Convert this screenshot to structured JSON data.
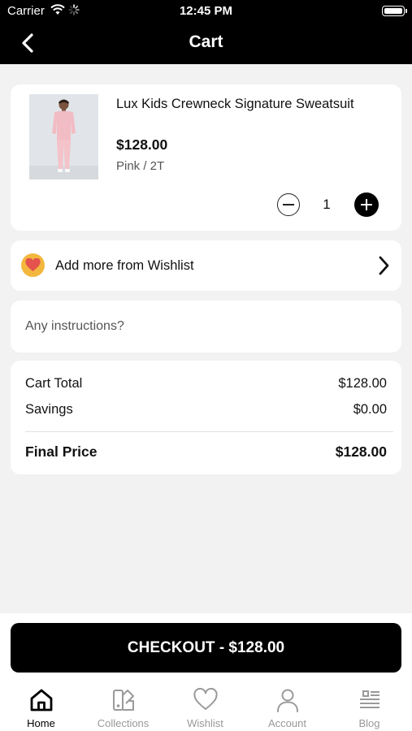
{
  "status_bar": {
    "carrier": "Carrier",
    "time": "12:45 PM"
  },
  "nav": {
    "title": "Cart",
    "back_icon": "chevron-left-icon"
  },
  "cart_item": {
    "name": "Lux Kids Crewneck Signature Sweatsuit",
    "price": "$128.00",
    "variant": "Pink / 2T",
    "quantity": "1"
  },
  "wishlist_row": {
    "label": "Add more from Wishlist",
    "icon": "heart-icon",
    "accent": "#f3b73e"
  },
  "instructions": {
    "placeholder": "Any instructions?"
  },
  "summary": {
    "cart_total_label": "Cart Total",
    "cart_total_value": "$128.00",
    "savings_label": "Savings",
    "savings_value": "$0.00",
    "final_label": "Final Price",
    "final_value": "$128.00"
  },
  "checkout": {
    "label": "CHECKOUT - $128.00"
  },
  "tabs": [
    {
      "label": "Home",
      "icon": "home-icon",
      "active": true
    },
    {
      "label": "Collections",
      "icon": "collections-icon",
      "active": false
    },
    {
      "label": "Wishlist",
      "icon": "heart-icon",
      "active": false
    },
    {
      "label": "Account",
      "icon": "person-icon",
      "active": false
    },
    {
      "label": "Blog",
      "icon": "blog-icon",
      "active": false
    }
  ],
  "colors": {
    "header": "#000000",
    "background": "#f2f2f2",
    "tab_inactive": "#999999",
    "heart": "#e4534d"
  }
}
